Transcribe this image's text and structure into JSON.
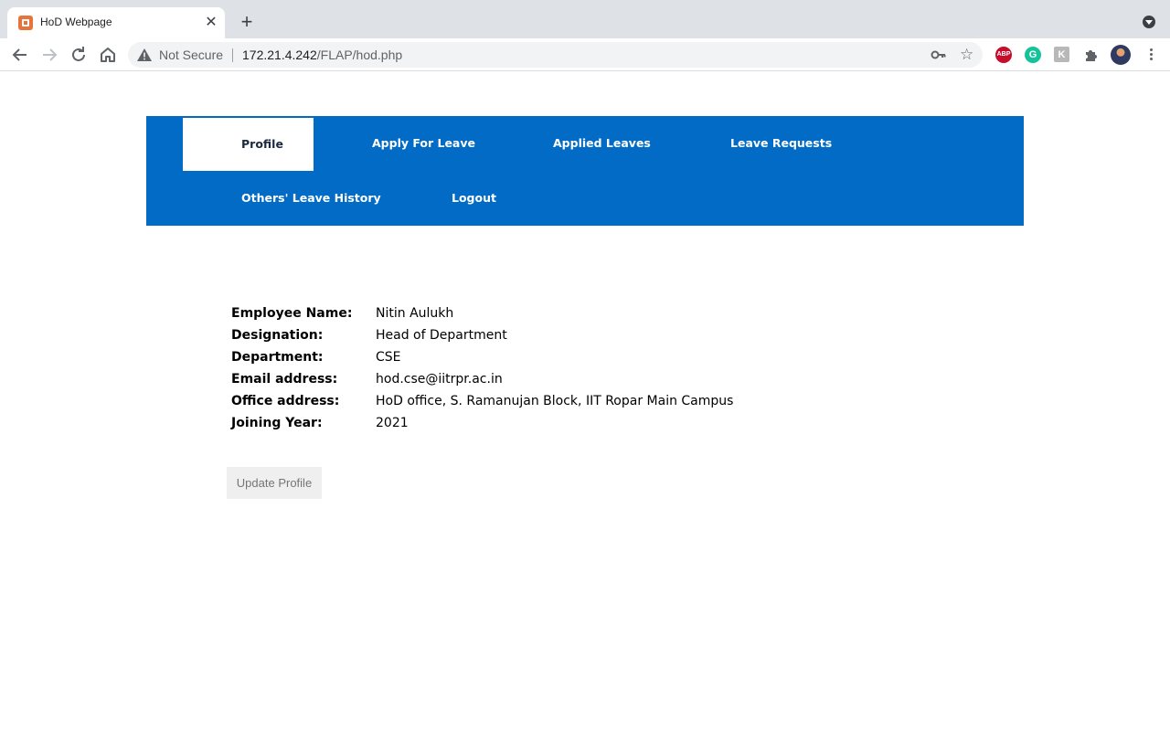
{
  "browser": {
    "tab_title": "HoD Webpage",
    "tab_close": "✕",
    "new_tab": "+",
    "security_label": "Not Secure",
    "url_host": "172.21.4.242",
    "url_path": "/FLAP/hod.php",
    "extensions": {
      "adblock": "ABP",
      "grammarly": "G",
      "generic": "K"
    }
  },
  "nav": {
    "profile": "Profile",
    "apply_leave": "Apply For Leave",
    "applied_leaves": "Applied Leaves",
    "leave_requests": "Leave Requests",
    "others_history": "Others' Leave History",
    "logout": "Logout",
    "active": "Profile",
    "bg_color": "#016bc6"
  },
  "profile": {
    "rows": [
      {
        "label": "Employee Name:",
        "value": "Nitin Aulukh"
      },
      {
        "label": "Designation:",
        "value": "Head of Department"
      },
      {
        "label": "Department:",
        "value": "CSE"
      },
      {
        "label": "Email address:",
        "value": "hod.cse@iitrpr.ac.in"
      },
      {
        "label": "Office address:",
        "value": "HoD office, S. Ramanujan Block, IIT Ropar Main Campus"
      },
      {
        "label": "Joining Year:",
        "value": "2021"
      }
    ],
    "update_button": "Update Profile"
  }
}
